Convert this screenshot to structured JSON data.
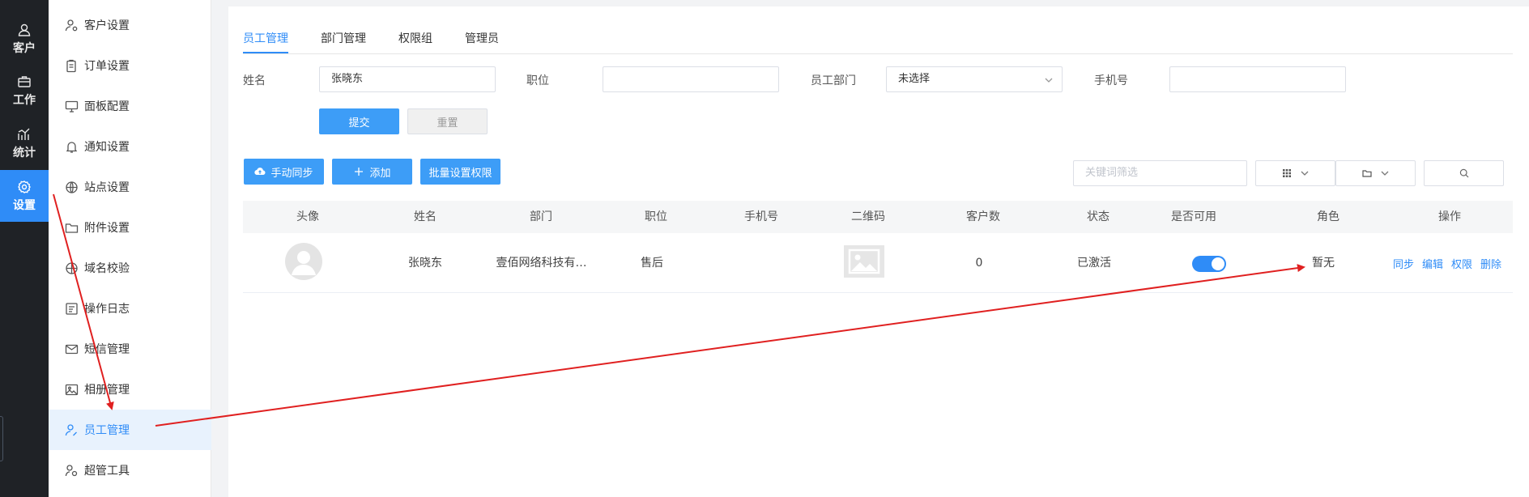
{
  "rail": {
    "items": [
      {
        "label": "客户",
        "icon": "user-icon"
      },
      {
        "label": "工作",
        "icon": "briefcase-icon"
      },
      {
        "label": "统计",
        "icon": "chart-icon"
      },
      {
        "label": "设置",
        "icon": "gear-icon"
      }
    ]
  },
  "sidebar": {
    "items": [
      {
        "label": "客户设置"
      },
      {
        "label": "订单设置"
      },
      {
        "label": "面板配置"
      },
      {
        "label": "通知设置"
      },
      {
        "label": "站点设置"
      },
      {
        "label": "附件设置"
      },
      {
        "label": "域名校验"
      },
      {
        "label": "操作日志"
      },
      {
        "label": "短信管理"
      },
      {
        "label": "相册管理"
      },
      {
        "label": "员工管理"
      },
      {
        "label": "超管工具"
      }
    ]
  },
  "tabs": [
    {
      "label": "员工管理"
    },
    {
      "label": "部门管理"
    },
    {
      "label": "权限组"
    },
    {
      "label": "管理员"
    }
  ],
  "filters": {
    "name_label": "姓名",
    "name_value": "张晓东",
    "position_label": "职位",
    "position_value": "",
    "dept_label": "员工部门",
    "dept_value": "未选择",
    "phone_label": "手机号",
    "phone_value": "",
    "submit_label": "提交",
    "reset_label": "重置"
  },
  "toolbar": {
    "sync_label": "手动同步",
    "add_label": "添加",
    "batch_label": "批量设置权限",
    "keyword_placeholder": "关键词筛选"
  },
  "table": {
    "columns": [
      "头像",
      "姓名",
      "部门",
      "职位",
      "手机号",
      "二维码",
      "客户数",
      "状态",
      "是否可用",
      "角色",
      "操作"
    ],
    "rows": [
      {
        "name": "张晓东",
        "dept": "壹佰网络科技有…",
        "position": "售后",
        "phone": "",
        "customers": "0",
        "status": "已激活",
        "enabled": true,
        "role": "暂无",
        "actions": [
          "同步",
          "编辑",
          "权限",
          "删除"
        ]
      }
    ]
  },
  "colors": {
    "accent": "#2f8cf7",
    "rail_bg": "#1f2226",
    "annotation": "#e02020"
  }
}
